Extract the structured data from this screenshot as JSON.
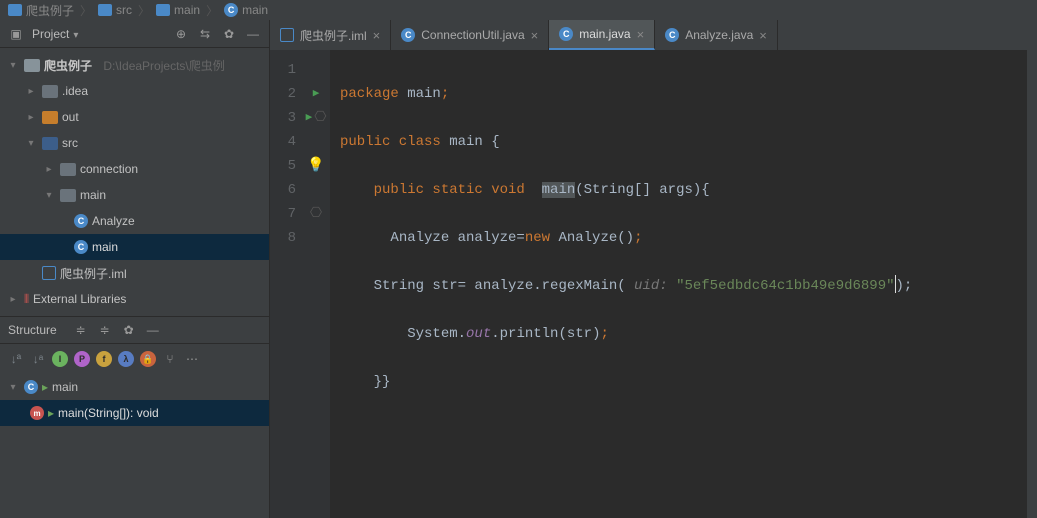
{
  "breadcrumb": [
    "爬虫例子",
    "src",
    "main",
    "main"
  ],
  "panel": {
    "title": "Project"
  },
  "tree": {
    "root": {
      "name": "爬虫例子",
      "path": "D:\\IdeaProjects\\爬虫例"
    },
    "idea": ".idea",
    "out": "out",
    "src": "src",
    "connection": "connection",
    "main": "main",
    "analyze": "Analyze",
    "main2": "main",
    "iml": "爬虫例子.iml",
    "extlib": "External Libraries"
  },
  "structure": {
    "title": "Structure",
    "class": "main",
    "method": "main(String[]): void"
  },
  "tabs": [
    {
      "label": "爬虫例子.iml",
      "icon": "module"
    },
    {
      "label": "ConnectionUtil.java",
      "icon": "c"
    },
    {
      "label": "main.java",
      "icon": "c",
      "active": true
    },
    {
      "label": "Analyze.java",
      "icon": "c"
    }
  ],
  "code": {
    "lines": [
      "1",
      "2",
      "3",
      "4",
      "5",
      "6",
      "7",
      "8"
    ],
    "l1_kw": "package ",
    "l1_id": "main",
    "l1_sc": ";",
    "l2_kw": "public class ",
    "l2_id": "main {",
    "l3_kw": "public static void  ",
    "l3_id": "main",
    "l3_rest": "(String[] args){",
    "l4a": "  Analyze analyze=",
    "l4_kw": "new ",
    "l4b": "Analyze()",
    "l4_sc": ";",
    "l5a": "String str= analyze.regexMain(",
    "l5_hint": " uid: ",
    "l5_str": "\"5ef5edbdc64c1bb49e9d6899\"",
    "l5_end": ");",
    "l6a": "    System.",
    "l6_f": "out",
    "l6b": ".println(str)",
    "l6_sc": ";",
    "l7": "}}"
  }
}
